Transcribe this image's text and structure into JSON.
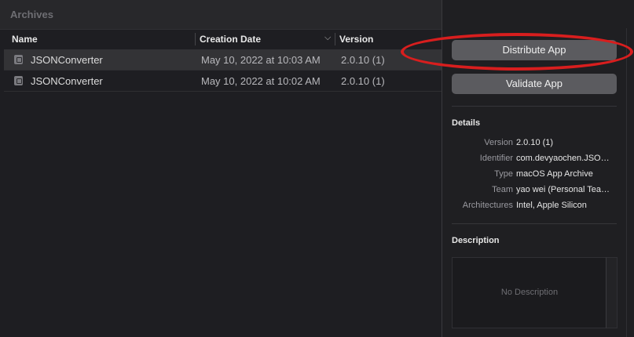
{
  "archives_title": "Archives",
  "columns": {
    "name": "Name",
    "creation_date": "Creation Date",
    "version": "Version"
  },
  "rows": [
    {
      "name": "JSONConverter",
      "date": "May 10, 2022 at 10:03 AM",
      "version": "2.0.10 (1)",
      "selected": true
    },
    {
      "name": "JSONConverter",
      "date": "May 10, 2022 at 10:02 AM",
      "version": "2.0.10 (1)",
      "selected": false
    }
  ],
  "buttons": {
    "distribute": "Distribute App",
    "validate": "Validate App"
  },
  "details": {
    "title": "Details",
    "items": [
      {
        "key": "Version",
        "value": "2.0.10 (1)"
      },
      {
        "key": "Identifier",
        "value": "com.devyaochen.JSO…"
      },
      {
        "key": "Type",
        "value": "macOS App Archive"
      },
      {
        "key": "Team",
        "value": "yao wei (Personal Tea…"
      },
      {
        "key": "Architectures",
        "value": "Intel, Apple Silicon"
      }
    ]
  },
  "description": {
    "title": "Description",
    "placeholder": "No Description"
  },
  "colors": {
    "highlight_ring": "#d81e1e",
    "button_bg": "#5b5b5f"
  }
}
